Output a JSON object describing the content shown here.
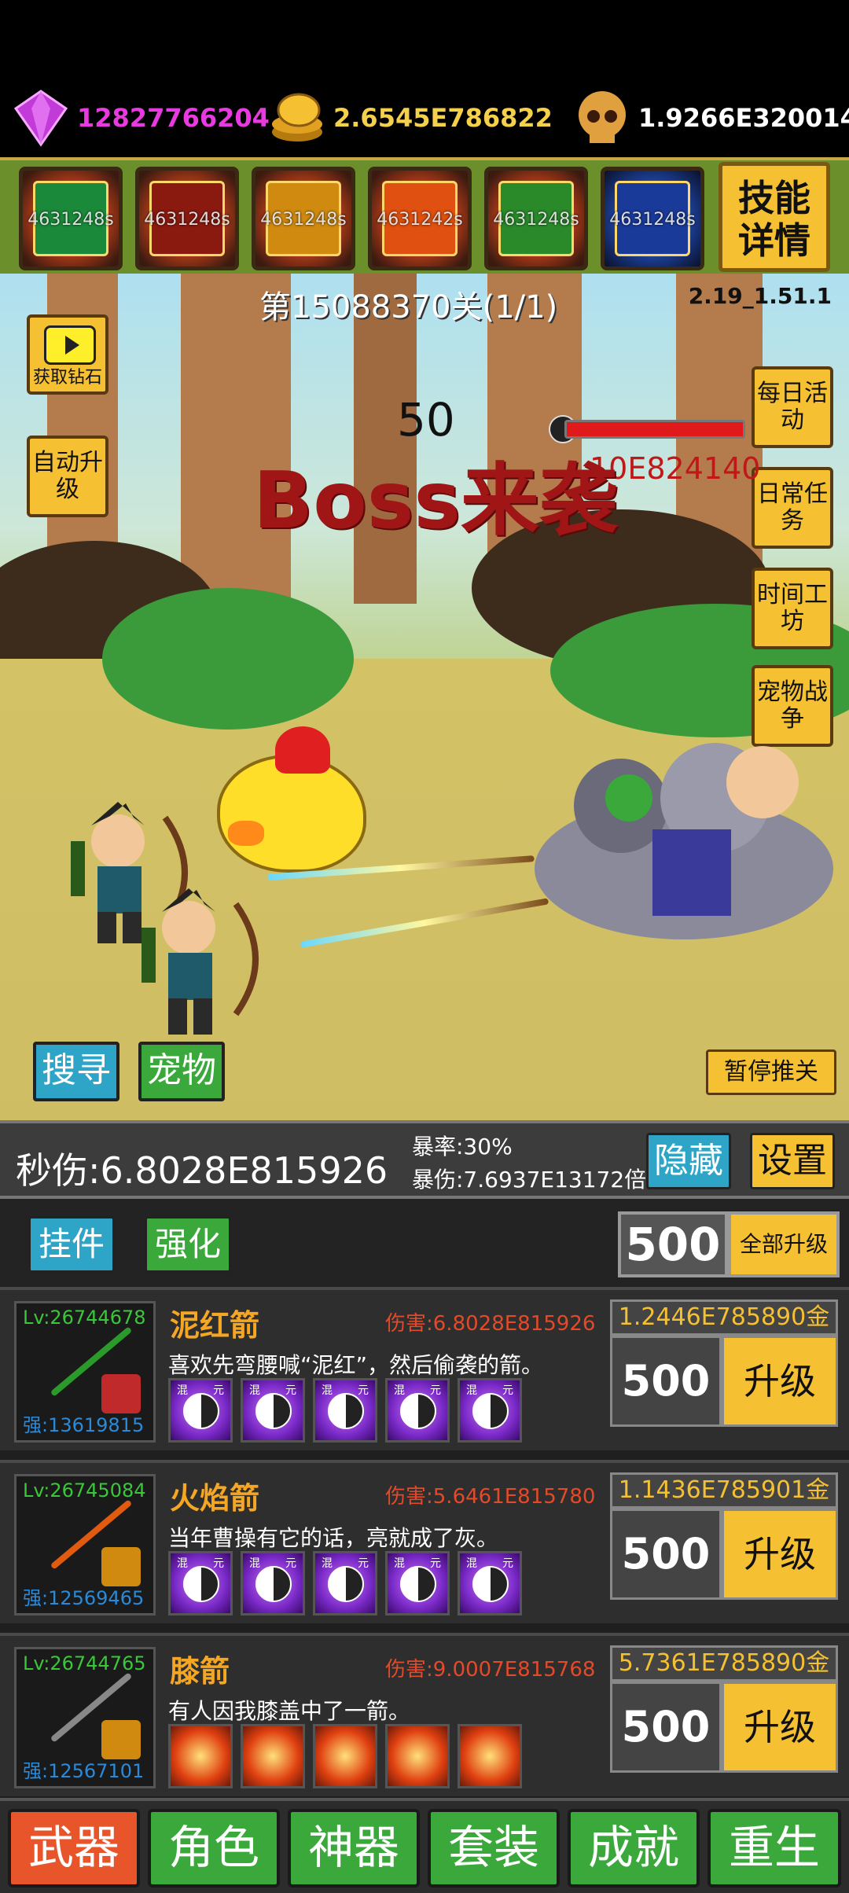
{
  "currencies": [
    {
      "icon": "diamond-icon",
      "value": "12827766204",
      "color": "#e83ae0"
    },
    {
      "icon": "coins-icon",
      "value": "2.6545E786822",
      "color": "#f5d04a"
    },
    {
      "icon": "skull-icon",
      "value": "1.9266E320014",
      "color": "#ffffff"
    }
  ],
  "skills": [
    {
      "icon": "skill-1-icon",
      "timer": "4631248s"
    },
    {
      "icon": "skill-2-icon",
      "timer": "4631248s"
    },
    {
      "icon": "skill-3-icon",
      "timer": "4631248s"
    },
    {
      "icon": "skill-4-icon",
      "timer": "4631242s"
    },
    {
      "icon": "skill-5-icon",
      "timer": "4631248s"
    },
    {
      "icon": "skill-6-icon",
      "timer": "4631248s"
    }
  ],
  "skill_detail_label": "技能详情",
  "stage": "第15088370关(1/1)",
  "version": "2.19_1.51.1",
  "left_buttons": {
    "video_label": "获取钻石",
    "auto_upgrade": "自动升级"
  },
  "right_buttons": [
    "每日活动",
    "日常任务",
    "时间工坊",
    "宠物战争"
  ],
  "boss": {
    "count": "50",
    "title": "Boss来袭",
    "hp": "10E824140",
    "hp_fraction": 1.0
  },
  "scene_buttons": {
    "search": "搜寻",
    "pet": "宠物",
    "pause": "暂停推关"
  },
  "stats": {
    "dps": "秒伤:6.8028E815926",
    "crit_rate": "暴率:30%",
    "crit_dmg": "暴伤:7.6937E13172倍",
    "hide": "隐藏",
    "settings": "设置"
  },
  "tabs": {
    "idle": "挂件",
    "enhance": "强化",
    "qty": "500",
    "all_upgrade": "全部升级"
  },
  "weapons": [
    {
      "level": "Lv:26744678",
      "strength": "强:13619815",
      "name": "泥红箭",
      "damage": "伤害:6.8028E815926",
      "desc": "喜欢先弯腰喊“泥红”，然后偷袭的箭。",
      "cost": "1.2446E785890金",
      "qty": "500",
      "upgrade": "升级",
      "rune_type": "yinyang",
      "rune_tag1": "混",
      "rune_tag2": "元"
    },
    {
      "level": "Lv:26745084",
      "strength": "强:12569465",
      "name": "火焰箭",
      "damage": "伤害:5.6461E815780",
      "desc": "当年曹操有它的话，亮就成了灰。",
      "cost": "1.1436E785901金",
      "qty": "500",
      "upgrade": "升级",
      "rune_type": "yinyang",
      "rune_tag1": "混",
      "rune_tag2": "元"
    },
    {
      "level": "Lv:26744765",
      "strength": "强:12567101",
      "name": "膝箭",
      "damage": "伤害:9.0007E815768",
      "desc": "有人因我膝盖中了一箭。",
      "cost": "5.7361E785890金",
      "qty": "500",
      "upgrade": "升级",
      "rune_type": "fire",
      "rune_tag1": "",
      "rune_tag2": ""
    }
  ],
  "nav": [
    {
      "label": "武器",
      "active": true
    },
    {
      "label": "角色",
      "active": false
    },
    {
      "label": "神器",
      "active": false
    },
    {
      "label": "套装",
      "active": false
    },
    {
      "label": "成就",
      "active": false
    },
    {
      "label": "重生",
      "active": false
    }
  ]
}
